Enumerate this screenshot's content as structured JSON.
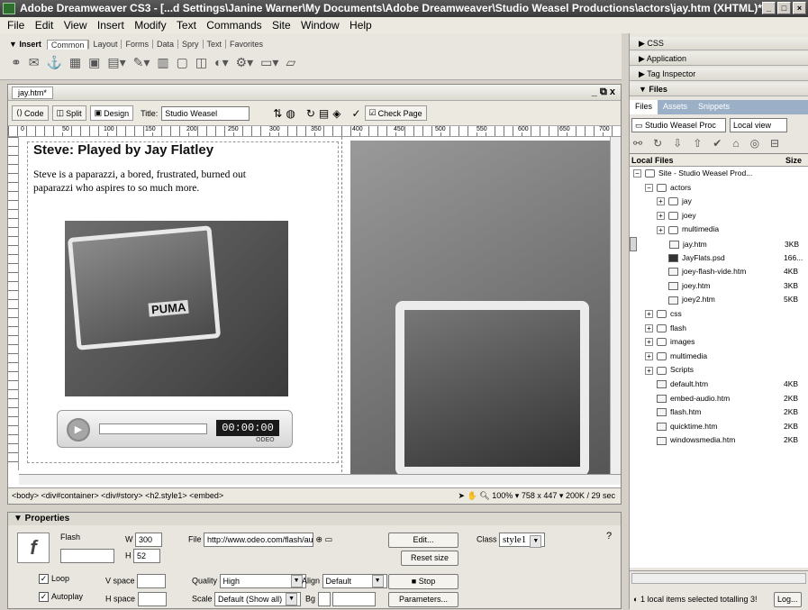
{
  "window": {
    "title": "Adobe Dreamweaver CS3 - [...d Settings\\Janine Warner\\My Documents\\Adobe Dreamweaver\\Studio Weasel Productions\\actors\\jay.htm (XHTML)*]"
  },
  "menu": [
    "File",
    "Edit",
    "View",
    "Insert",
    "Modify",
    "Text",
    "Commands",
    "Site",
    "Window",
    "Help"
  ],
  "insert_bar": {
    "label": "▼ Insert",
    "tabs": [
      "Common",
      "Layout",
      "Forms",
      "Data",
      "Spry",
      "Text",
      "Favorites"
    ]
  },
  "document": {
    "tab_name": "jay.htm*",
    "window_controls": "_ ⧉ x",
    "view_buttons": [
      "Code",
      "Split",
      "Design"
    ],
    "title_label": "Title:",
    "title_value": "Studio Weasel",
    "check_page": "Check Page",
    "ruler_ticks": [
      "0",
      "50",
      "100",
      "150",
      "200",
      "250",
      "300",
      "350",
      "400",
      "450",
      "500",
      "550",
      "600",
      "650",
      "700"
    ],
    "heading": "Steve: Played by Jay Flatley",
    "paragraph": "Steve is a paparazzi, a bored, frustrated, burned out paparazzi who aspires to so much more.",
    "photo_text": "PUMA",
    "player": {
      "time": "00:00:00",
      "brand": "ODEO"
    },
    "tag_selector": "<body> <div#container> <div#story> <h2.style1> <embed>",
    "zoom": "100%",
    "dimensions": "758 x 447",
    "download": "200K / 29 sec"
  },
  "properties": {
    "header": "▼ Properties",
    "type": "Flash",
    "w_label": "W",
    "w_value": "300",
    "h_label": "H",
    "h_value": "52",
    "file_label": "File",
    "file_value": "http://www.odeo.com/flash/audio_",
    "edit_button": "Edit...",
    "reset_button": "Reset size",
    "class_label": "Class",
    "class_value": "style1",
    "loop_label": "Loop",
    "autoplay_label": "Autoplay",
    "vspace_label": "V space",
    "hspace_label": "H space",
    "quality_label": "Quality",
    "quality_value": "High",
    "scale_label": "Scale",
    "scale_value": "Default (Show all)",
    "align_label": "Align",
    "align_value": "Default",
    "bg_label": "Bg",
    "stop_button": "Stop",
    "parameters_button": "Parameters..."
  },
  "panels": {
    "groups": [
      "▶ CSS",
      "▶ Application",
      "▶ Tag Inspector",
      "▼ Files"
    ],
    "file_tabs": [
      "Files",
      "Assets",
      "Snippets"
    ],
    "site_select": "Studio Weasel Proc",
    "view_select": "Local view",
    "col_local": "Local Files",
    "col_size": "Size",
    "files": [
      {
        "name": "Site - Studio Weasel Prod...",
        "size": "",
        "indent": 0,
        "kind": "folder",
        "exp": "−"
      },
      {
        "name": "actors",
        "size": "",
        "indent": 1,
        "kind": "folder",
        "exp": "−"
      },
      {
        "name": "jay",
        "size": "",
        "indent": 2,
        "kind": "folder",
        "exp": "+"
      },
      {
        "name": "joey",
        "size": "",
        "indent": 2,
        "kind": "folder",
        "exp": "+"
      },
      {
        "name": "multimedia",
        "size": "",
        "indent": 2,
        "kind": "folder",
        "exp": "+"
      },
      {
        "name": "jay.htm",
        "size": "3KB",
        "indent": 3,
        "kind": "file",
        "exp": ""
      },
      {
        "name": "JayFlats.psd",
        "size": "166...",
        "indent": 3,
        "kind": "psd",
        "exp": ""
      },
      {
        "name": "joey-flash-vide.htm",
        "size": "4KB",
        "indent": 3,
        "kind": "file",
        "exp": ""
      },
      {
        "name": "joey.htm",
        "size": "3KB",
        "indent": 3,
        "kind": "file",
        "exp": ""
      },
      {
        "name": "joey2.htm",
        "size": "5KB",
        "indent": 3,
        "kind": "file",
        "exp": ""
      },
      {
        "name": "css",
        "size": "",
        "indent": 1,
        "kind": "folder",
        "exp": "+"
      },
      {
        "name": "flash",
        "size": "",
        "indent": 1,
        "kind": "folder",
        "exp": "+"
      },
      {
        "name": "images",
        "size": "",
        "indent": 1,
        "kind": "folder",
        "exp": "+"
      },
      {
        "name": "multimedia",
        "size": "",
        "indent": 1,
        "kind": "folder",
        "exp": "+"
      },
      {
        "name": "Scripts",
        "size": "",
        "indent": 1,
        "kind": "folder",
        "exp": "+"
      },
      {
        "name": "default.htm",
        "size": "4KB",
        "indent": 2,
        "kind": "file",
        "exp": ""
      },
      {
        "name": "embed-audio.htm",
        "size": "2KB",
        "indent": 2,
        "kind": "file",
        "exp": ""
      },
      {
        "name": "flash.htm",
        "size": "2KB",
        "indent": 2,
        "kind": "file",
        "exp": ""
      },
      {
        "name": "quicktime.htm",
        "size": "2KB",
        "indent": 2,
        "kind": "file",
        "exp": ""
      },
      {
        "name": "windowsmedia.htm",
        "size": "2KB",
        "indent": 2,
        "kind": "file",
        "exp": ""
      }
    ],
    "selected_file": "jay.htm",
    "status": "1 local items selected totalling 3!",
    "log_button": "Log..."
  }
}
